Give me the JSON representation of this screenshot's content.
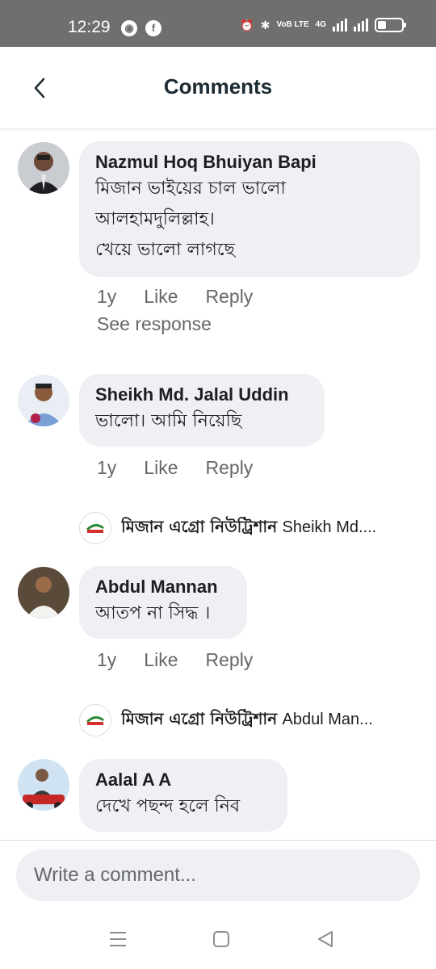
{
  "status_bar": {
    "time": "12:29",
    "app_icons": [
      "vpn-icon",
      "facebook-icon"
    ],
    "network": "4G",
    "volte": "VoB LTE",
    "battery_level": 0.35
  },
  "header": {
    "title": "Comments",
    "back_icon": "chevron-left-icon"
  },
  "comments": [
    {
      "name": "Nazmul Hoq Bhuiyan Bapi",
      "text": "মিজান ভাইয়ের চাল ভালো\nআলহামদুলিল্লাহ।\nখেয়ে ভালো লাগছে",
      "age": "1y",
      "like": "Like",
      "reply": "Reply",
      "see_response": "See response"
    },
    {
      "name": "Sheikh Md. Jalal Uddin",
      "text": "ভালো।  আমি নিয়েছি",
      "age": "1y",
      "like": "Like",
      "reply": "Reply",
      "reply_preview": {
        "author": "মিজান এগ্রো নিউট্রিশান",
        "snippet": "Sheikh Md...."
      }
    },
    {
      "name": "Abdul Mannan",
      "text": "আতপ না সিদ্ধ ।",
      "age": "1y",
      "like": "Like",
      "reply": "Reply",
      "reply_preview": {
        "author": "মিজান এগ্রো নিউট্রিশান",
        "snippet": "Abdul Man..."
      }
    },
    {
      "name": "Aalal A A",
      "text": "দেখে পছন্দ হলে নিব"
    }
  ],
  "composer": {
    "placeholder": "Write a comment..."
  },
  "nav_bar": {
    "icons": [
      "menu-icon",
      "home-square-icon",
      "back-triangle-icon"
    ]
  },
  "colors": {
    "status_bar": "#6f6f6f",
    "bubble": "#eef0f3",
    "meta_text": "#65676b",
    "title": "#1c2b33"
  }
}
